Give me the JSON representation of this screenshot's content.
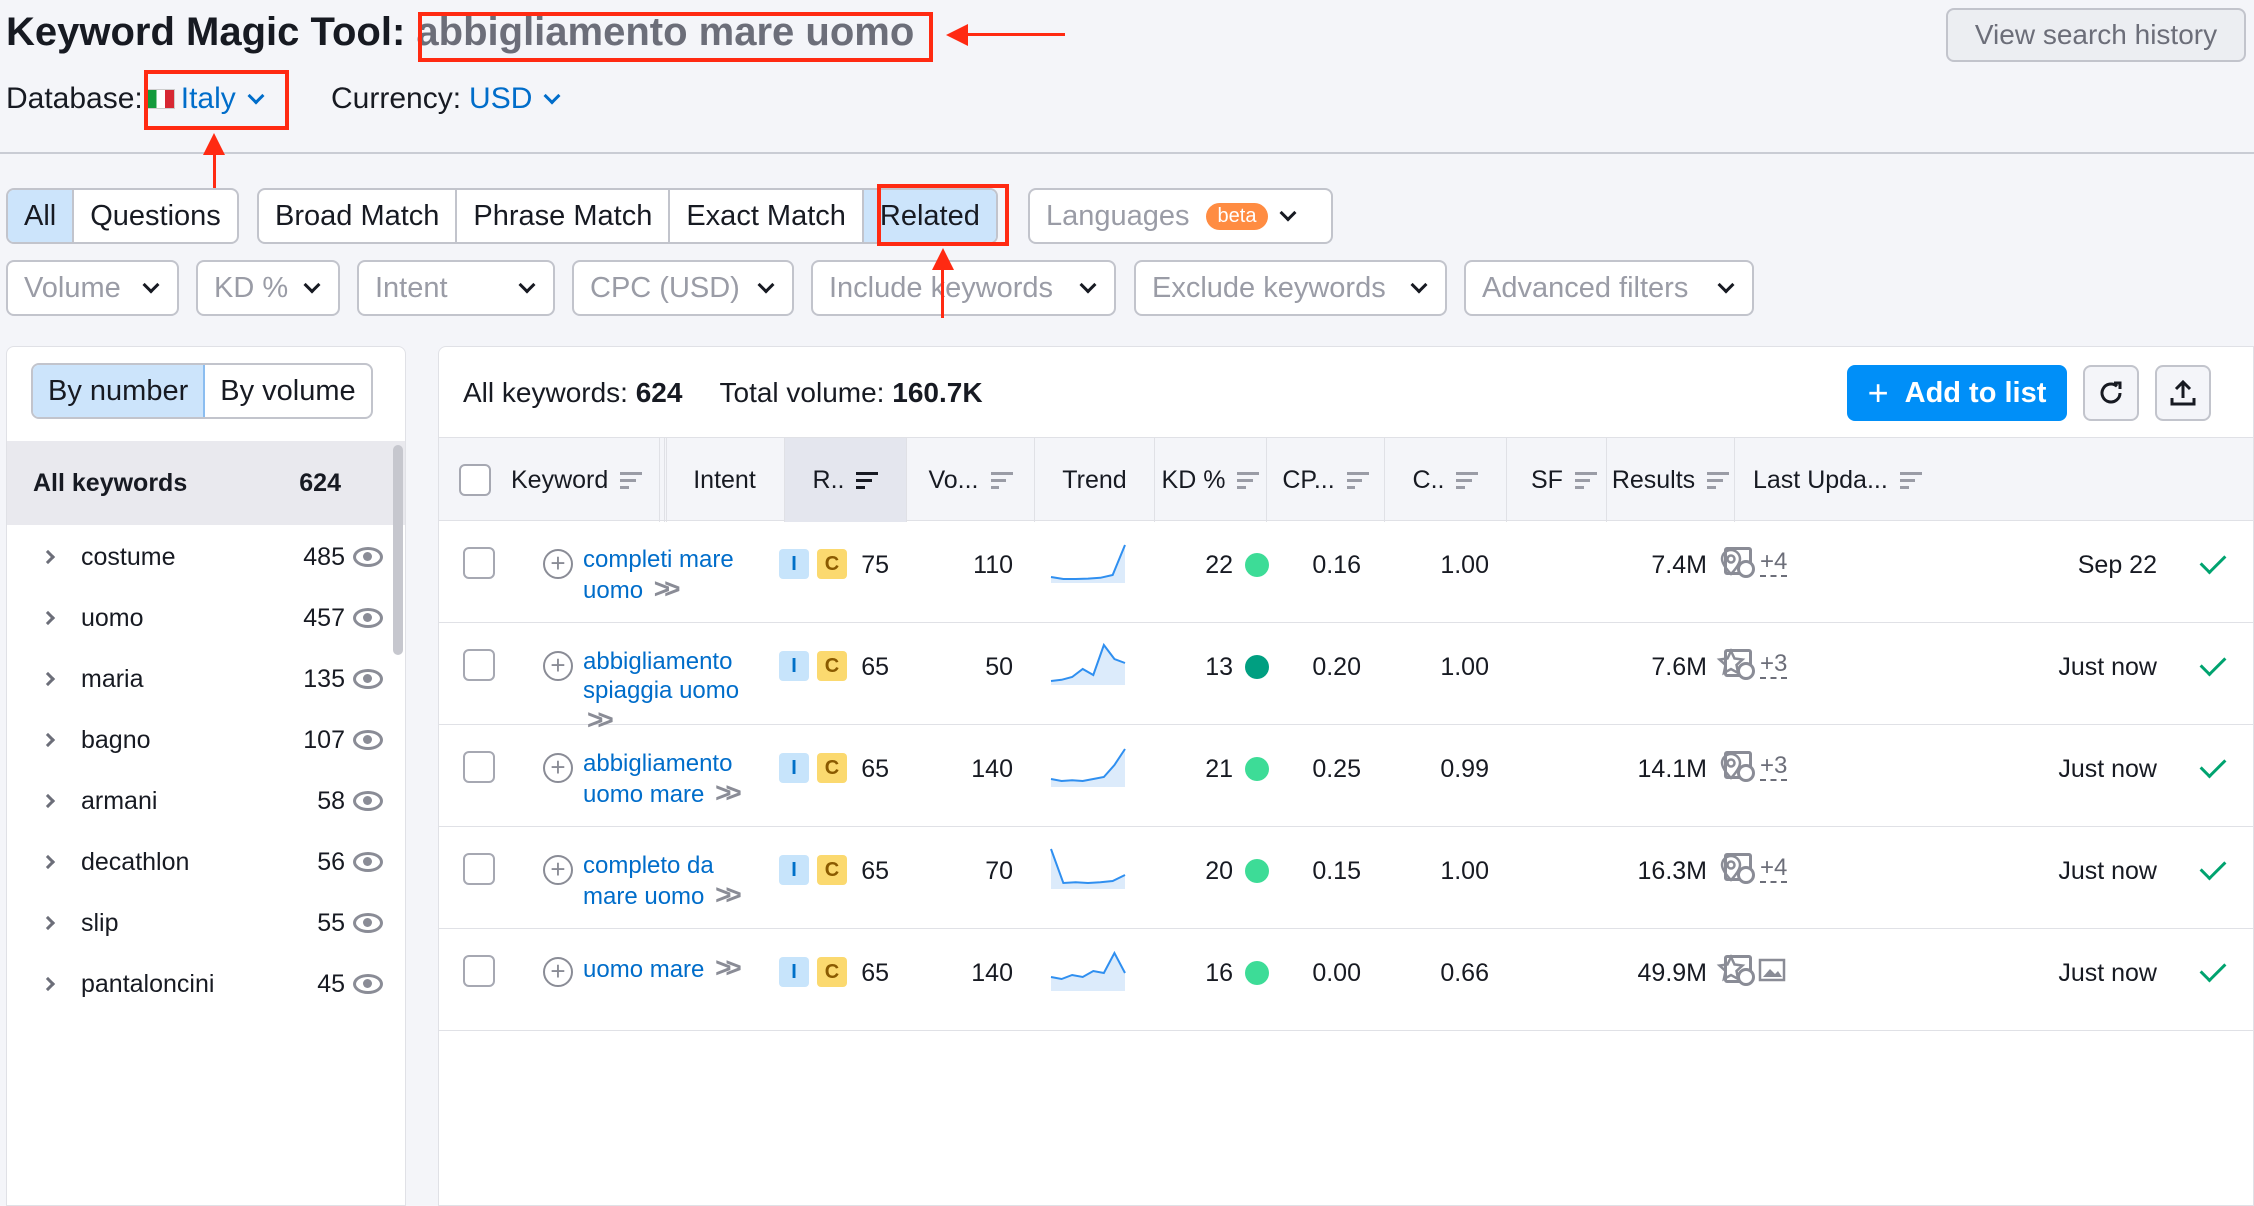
{
  "header": {
    "title_prefix": "Keyword Magic Tool:",
    "query": "abbigliamento mare uomo",
    "history_button": "View search history",
    "database_label": "Database:",
    "database_value": "Italy",
    "currency_label": "Currency:",
    "currency_value": "USD"
  },
  "match_tabs": {
    "group1": [
      "All",
      "Questions"
    ],
    "group2": [
      "Broad Match",
      "Phrase Match",
      "Exact Match",
      "Related"
    ],
    "active": [
      "All",
      "Related"
    ]
  },
  "languages": {
    "label": "Languages",
    "badge": "beta"
  },
  "filters": [
    "Volume",
    "KD %",
    "Intent",
    "CPC (USD)",
    "Include keywords",
    "Exclude keywords",
    "Advanced filters"
  ],
  "sidebar": {
    "toggle": [
      "By number",
      "By volume"
    ],
    "all_label": "All keywords",
    "all_count": "624",
    "groups": [
      {
        "name": "costume",
        "count": "485"
      },
      {
        "name": "uomo",
        "count": "457"
      },
      {
        "name": "maria",
        "count": "135"
      },
      {
        "name": "bagno",
        "count": "107"
      },
      {
        "name": "armani",
        "count": "58"
      },
      {
        "name": "decathlon",
        "count": "56"
      },
      {
        "name": "slip",
        "count": "55"
      },
      {
        "name": "pantaloncini",
        "count": "45"
      }
    ]
  },
  "summary": {
    "all_label": "All keywords:",
    "all_value": "624",
    "vol_label": "Total volume:",
    "vol_value": "160.7K",
    "add_button": "Add to list"
  },
  "table": {
    "headers": [
      "Keyword",
      "Intent",
      "R..",
      "Vo...",
      "Trend",
      "KD %",
      "CP...",
      "C..",
      "SF",
      "Results",
      "Last Upda..."
    ],
    "rows": [
      {
        "keyword": "completi mare uomo",
        "intent": [
          "I",
          "C"
        ],
        "relevance": "75",
        "volume": "110",
        "kd": "22",
        "kd_color": "#3ddc97",
        "cpc": "0.16",
        "com": "1.00",
        "sf_icon": "pin-icon",
        "sf_more": "+4",
        "results": "7.4M",
        "updated": "Sep 22",
        "trend": [
          0.1,
          0.05,
          0.05,
          0.06,
          0.08,
          0.15,
          0.9
        ]
      },
      {
        "keyword": "abbigliamento spiaggia uomo",
        "intent": [
          "I",
          "C"
        ],
        "relevance": "65",
        "volume": "50",
        "kd": "13",
        "kd_color": "#009f81",
        "cpc": "0.20",
        "com": "1.00",
        "sf_icon": "star-icon",
        "sf_more": "+3",
        "results": "7.6M",
        "updated": "Just now",
        "trend": [
          0.05,
          0.08,
          0.15,
          0.35,
          0.2,
          0.95,
          0.6,
          0.5
        ]
      },
      {
        "keyword": "abbigliamento uomo mare",
        "intent": [
          "I",
          "C"
        ],
        "relevance": "65",
        "volume": "140",
        "kd": "21",
        "kd_color": "#3ddc97",
        "cpc": "0.25",
        "com": "0.99",
        "sf_icon": "pin-icon",
        "sf_more": "+3",
        "results": "14.1M",
        "updated": "Just now",
        "trend": [
          0.15,
          0.1,
          0.12,
          0.1,
          0.15,
          0.2,
          0.5,
          0.9
        ]
      },
      {
        "keyword": "completo da mare uomo",
        "intent": [
          "I",
          "C"
        ],
        "relevance": "65",
        "volume": "70",
        "kd": "20",
        "kd_color": "#3ddc97",
        "cpc": "0.15",
        "com": "1.00",
        "sf_icon": "pin-icon",
        "sf_more": "+4",
        "results": "16.3M",
        "updated": "Just now",
        "trend": [
          0.95,
          0.1,
          0.12,
          0.1,
          0.12,
          0.15,
          0.3
        ]
      },
      {
        "keyword": "uomo mare",
        "intent": [
          "I",
          "C"
        ],
        "relevance": "65",
        "volume": "140",
        "kd": "16",
        "kd_color": "#3ddc97",
        "cpc": "0.00",
        "com": "0.66",
        "sf_icon": "star-icon",
        "sf_more": "image-icon",
        "results": "49.9M",
        "updated": "Just now",
        "trend": [
          0.3,
          0.25,
          0.35,
          0.3,
          0.45,
          0.4,
          0.9,
          0.4
        ]
      }
    ]
  }
}
